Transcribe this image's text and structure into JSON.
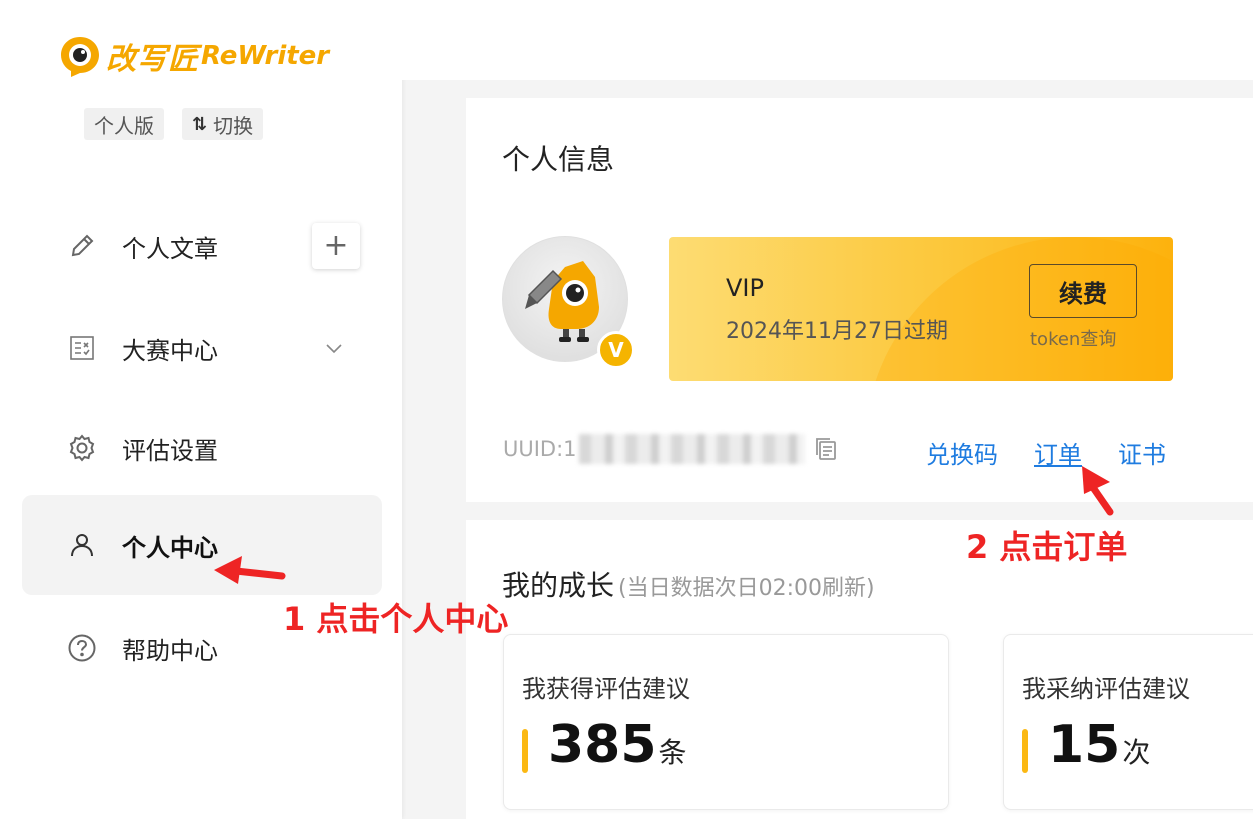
{
  "brand": {
    "name_cn": "改写匠",
    "name_en": "ReWriter",
    "accent": "#f5a700"
  },
  "edition": {
    "label": "个人版",
    "switch_label": "切换"
  },
  "sidebar": {
    "items": [
      {
        "label": "个人文章",
        "icon": "pencil-icon"
      },
      {
        "label": "大赛中心",
        "icon": "contest-icon"
      },
      {
        "label": "评估设置",
        "icon": "gear-icon"
      },
      {
        "label": "个人中心",
        "icon": "user-icon",
        "active": true
      },
      {
        "label": "帮助中心",
        "icon": "help-icon"
      }
    ]
  },
  "info": {
    "title": "个人信息",
    "vip_title": "VIP",
    "vip_expire": "2024年11月27日过期",
    "renew_label": "续费",
    "token_label": "token查询",
    "uuid_label": "UUID:1",
    "links": [
      "兑换码",
      "订单",
      "证书"
    ],
    "badge": "V"
  },
  "growth": {
    "title": "我的成长",
    "note": "(当日数据次日02:00刷新)",
    "stats": [
      {
        "label": "我获得评估建议",
        "value": "385",
        "unit": "条"
      },
      {
        "label": "我采纳评估建议",
        "value": "15",
        "unit": "次"
      }
    ]
  },
  "annotations": {
    "step1": "1 点击个人中心",
    "step2": "2 点击订单",
    "color": "#ee2424"
  }
}
